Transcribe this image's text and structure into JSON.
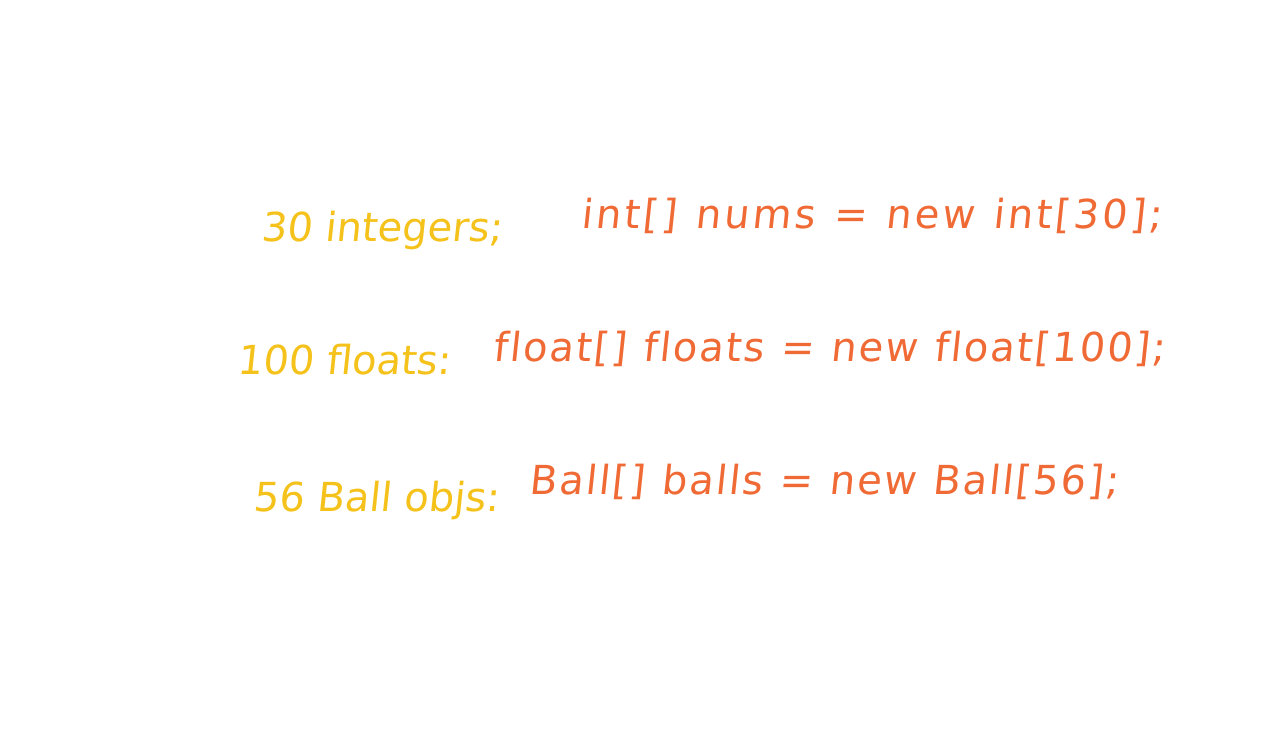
{
  "colors": {
    "label": "#f5c21b",
    "code": "#f06a35",
    "background": "#ffffff"
  },
  "rows": [
    {
      "label": "30 integers;",
      "code": "int[] nums = new int[30];"
    },
    {
      "label": "100 floats:",
      "code": "float[] floats = new float[100];"
    },
    {
      "label": "56 Ball objs:",
      "code": "Ball[] balls = new Ball[56];"
    }
  ]
}
